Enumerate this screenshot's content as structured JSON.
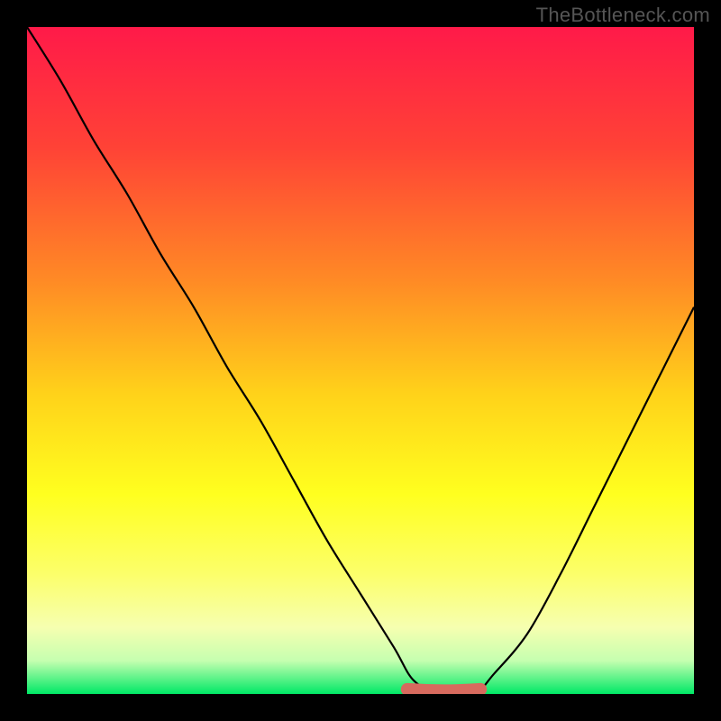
{
  "watermark": "TheBottleneck.com",
  "chart_data": {
    "type": "line",
    "title": "",
    "xlabel": "",
    "ylabel": "",
    "xlim": [
      0,
      100
    ],
    "ylim": [
      0,
      100
    ],
    "legend": false,
    "grid": false,
    "background_gradient": {
      "stops": [
        {
          "pos": 0.0,
          "color": "#ff1a49"
        },
        {
          "pos": 0.18,
          "color": "#ff4236"
        },
        {
          "pos": 0.38,
          "color": "#ff8a25"
        },
        {
          "pos": 0.55,
          "color": "#ffd21a"
        },
        {
          "pos": 0.7,
          "color": "#ffff1f"
        },
        {
          "pos": 0.82,
          "color": "#fcff6a"
        },
        {
          "pos": 0.9,
          "color": "#f6ffb0"
        },
        {
          "pos": 0.95,
          "color": "#c6ffb0"
        },
        {
          "pos": 1.0,
          "color": "#00e866"
        }
      ]
    },
    "series": [
      {
        "name": "bottleneck-curve",
        "color": "#000000",
        "x": [
          0,
          5,
          10,
          15,
          20,
          25,
          30,
          35,
          40,
          45,
          50,
          55,
          58,
          62,
          67,
          70,
          75,
          80,
          85,
          90,
          95,
          100
        ],
        "y": [
          100,
          92,
          83,
          75,
          66,
          58,
          49,
          41,
          32,
          23,
          15,
          7,
          2,
          0,
          0,
          3,
          9,
          18,
          28,
          38,
          48,
          58
        ]
      },
      {
        "name": "flat-bottom-marker",
        "color": "#d76a5e",
        "style": "thick-rounded",
        "x": [
          57,
          68
        ],
        "y": [
          0.7,
          0.7
        ]
      }
    ],
    "annotations": []
  }
}
